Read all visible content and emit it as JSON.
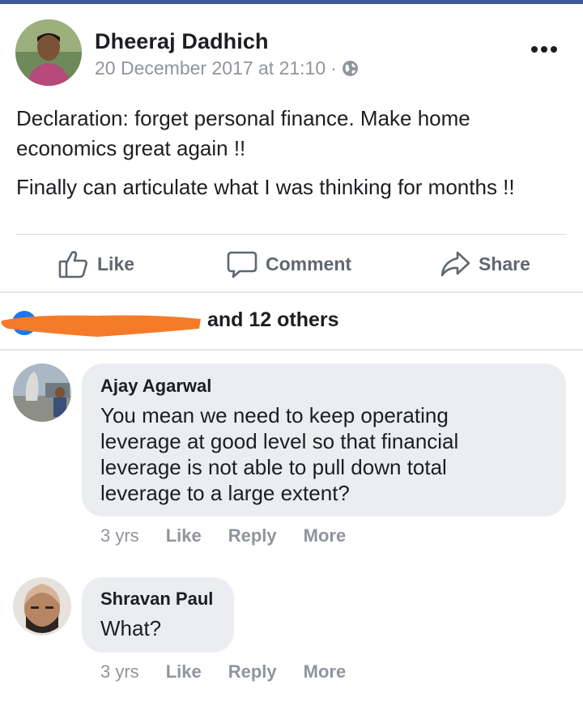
{
  "post": {
    "author": "Dheeraj Dadhich",
    "timestamp": "20 December 2017 at 21:10",
    "separator": "·",
    "audience_icon": "globe-icon",
    "menu_icon": "more-options-icon",
    "paragraphs": [
      "Declaration: forget personal finance. Make home economics great again !!",
      "Finally can articulate what I was thinking for months !!"
    ]
  },
  "actions": {
    "like": "Like",
    "comment": "Comment",
    "share": "Share"
  },
  "reactions": {
    "summary": "and 12 others"
  },
  "comments": [
    {
      "author": "Ajay Agarwal",
      "lines": [
        "You mean we need to keep operating",
        "leverage at good level so that financial",
        "leverage is not able to pull down total",
        "leverage to a large extent?"
      ],
      "time": "3 yrs",
      "like": "Like",
      "reply": "Reply",
      "more": "More"
    },
    {
      "author": "Shravan Paul",
      "lines": [
        "What?"
      ],
      "time": "3 yrs",
      "like": "Like",
      "reply": "Reply",
      "more": "More"
    }
  ],
  "colors": {
    "accent_bar": "#3b5998",
    "secondary_text": "#90949c",
    "bubble": "#ebedf0",
    "redaction": "#f47b2a"
  }
}
